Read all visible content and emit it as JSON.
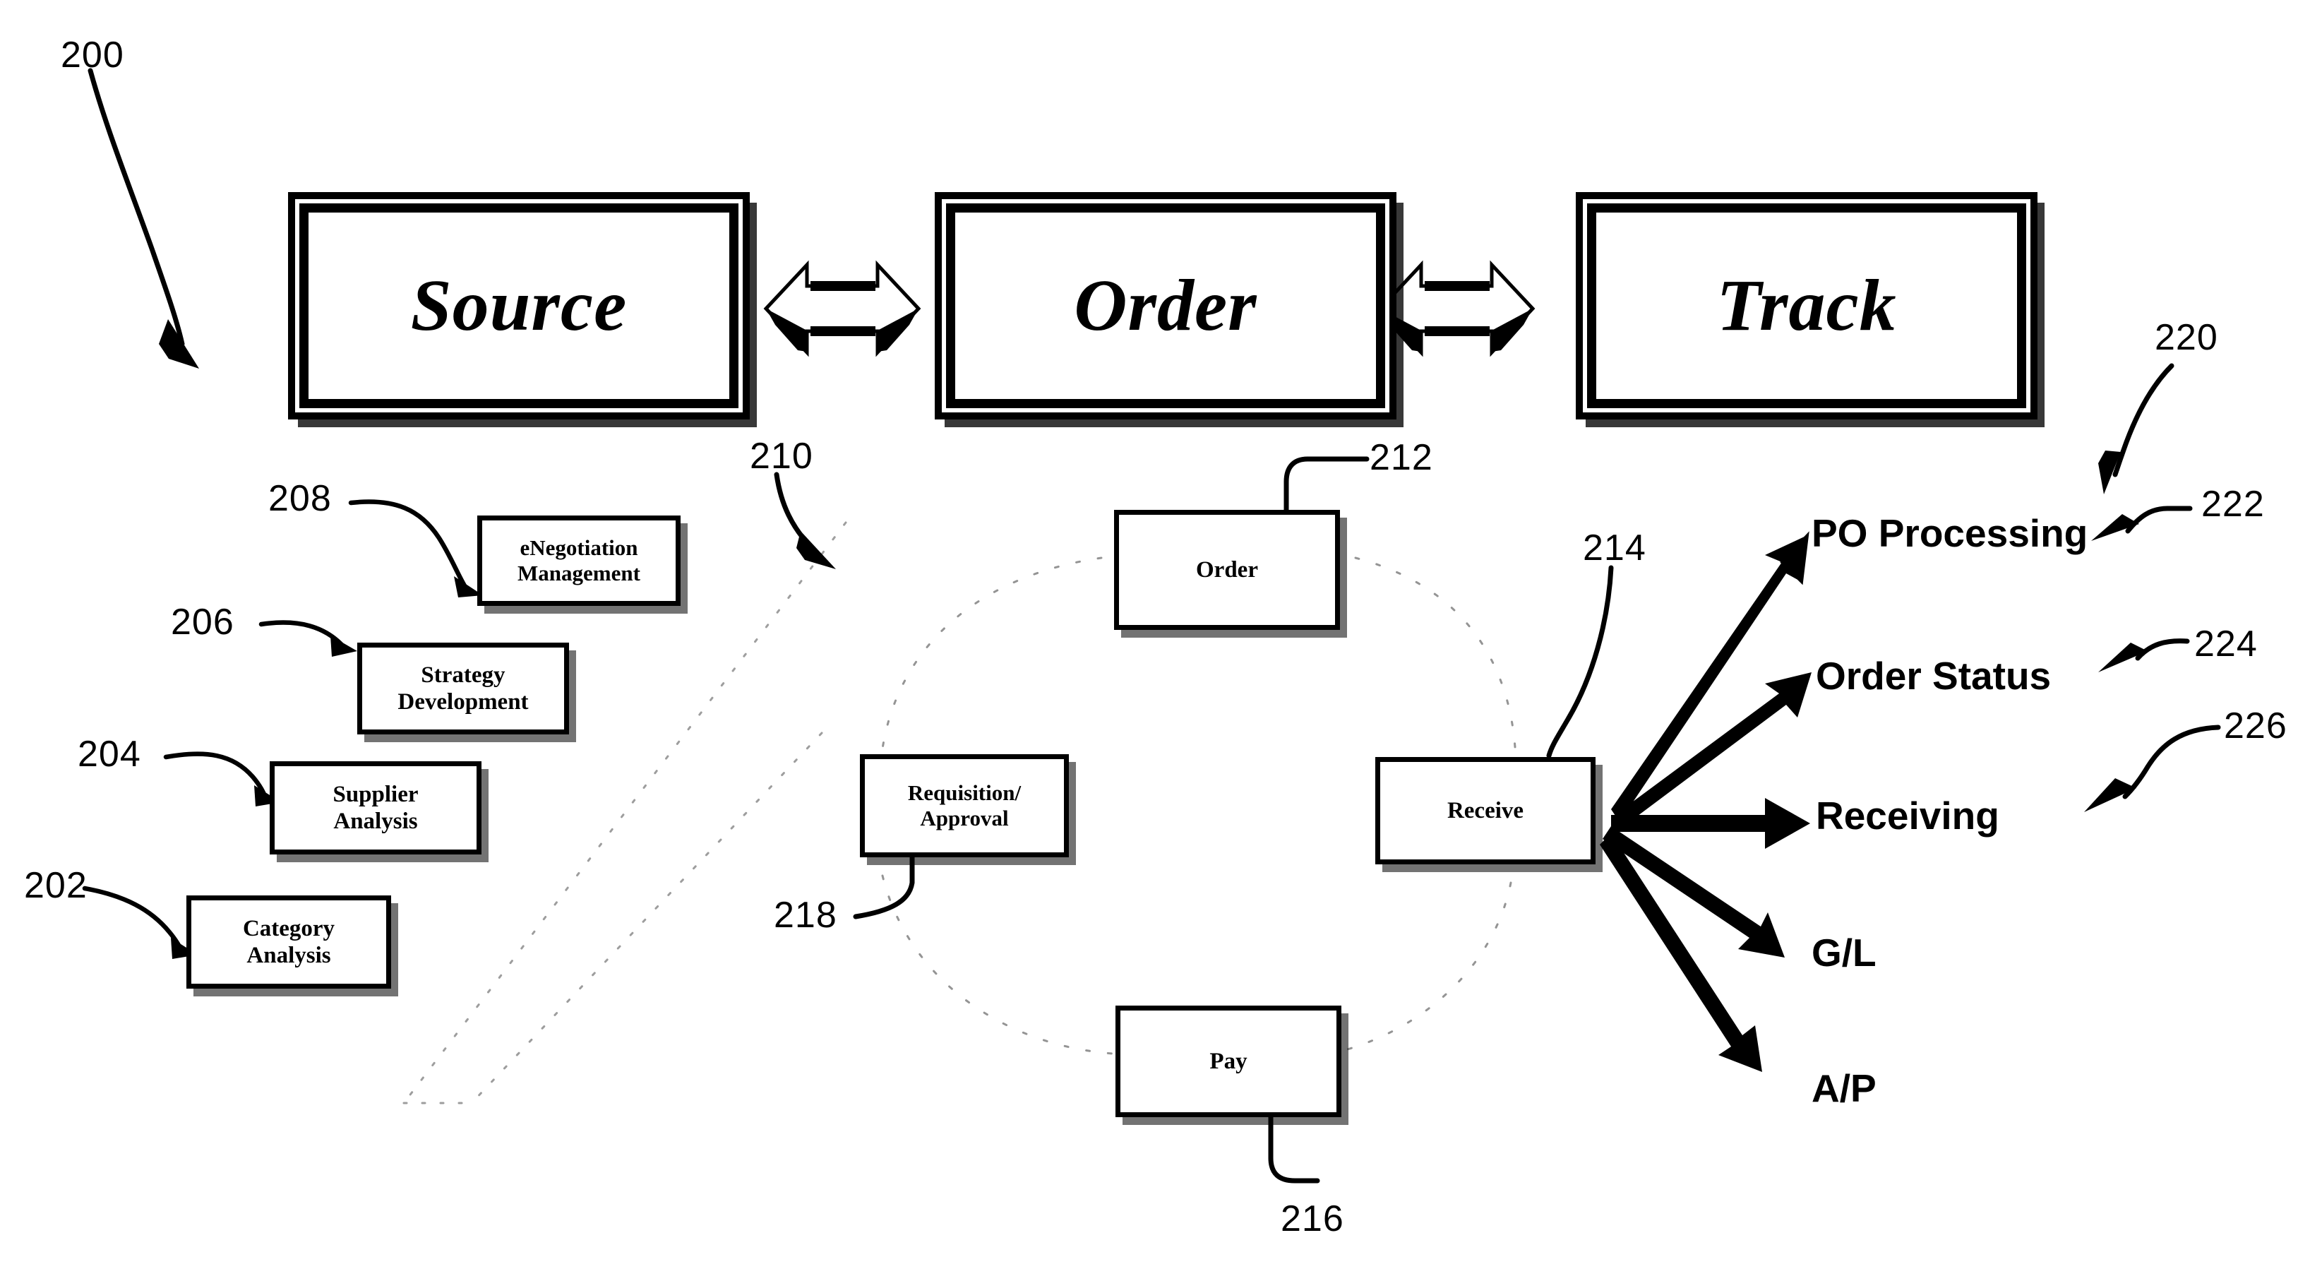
{
  "figure": {
    "number": "200",
    "kind": "patent-flow-diagram",
    "ink_color": "#000000",
    "background_color": "#ffffff"
  },
  "banners": [
    {
      "id": "source",
      "label": "Source"
    },
    {
      "id": "order",
      "label": "Order"
    },
    {
      "id": "track",
      "label": "Track"
    }
  ],
  "connectors": {
    "source_to_order": "bidirectional-block-arrow",
    "order_to_track": "bidirectional-block-arrow"
  },
  "source_group": {
    "items": [
      {
        "ref": "208",
        "label": "eNegotiation\nManagement"
      },
      {
        "ref": "206",
        "label": "Strategy\nDevelopment"
      },
      {
        "ref": "204",
        "label": "Supplier\nAnalysis"
      },
      {
        "ref": "202",
        "label": "Category\nAnalysis"
      }
    ]
  },
  "order_group": {
    "ref": "210",
    "items": [
      {
        "ref": "212",
        "label": "Order"
      },
      {
        "ref": "214",
        "label": "Receive"
      },
      {
        "ref": "216",
        "label": "Pay"
      },
      {
        "ref": "218",
        "label": "Requisition/\nApproval"
      }
    ]
  },
  "track_group": {
    "ref": "220",
    "items": [
      {
        "ref": "222",
        "label": "PO Processing"
      },
      {
        "ref": "224",
        "label": "Order Status"
      },
      {
        "ref": "226",
        "label": "Receiving"
      },
      {
        "ref": "",
        "label": "G/L"
      },
      {
        "ref": "",
        "label": "A/P"
      }
    ]
  },
  "reference_numerals": [
    {
      "id": "n200",
      "text": "200"
    },
    {
      "id": "n202",
      "text": "202"
    },
    {
      "id": "n204",
      "text": "204"
    },
    {
      "id": "n206",
      "text": "206"
    },
    {
      "id": "n208",
      "text": "208"
    },
    {
      "id": "n210",
      "text": "210"
    },
    {
      "id": "n212",
      "text": "212"
    },
    {
      "id": "n214",
      "text": "214"
    },
    {
      "id": "n216",
      "text": "216"
    },
    {
      "id": "n218",
      "text": "218"
    },
    {
      "id": "n220",
      "text": "220"
    },
    {
      "id": "n222",
      "text": "222"
    },
    {
      "id": "n224",
      "text": "224"
    },
    {
      "id": "n226",
      "text": "226"
    }
  ]
}
